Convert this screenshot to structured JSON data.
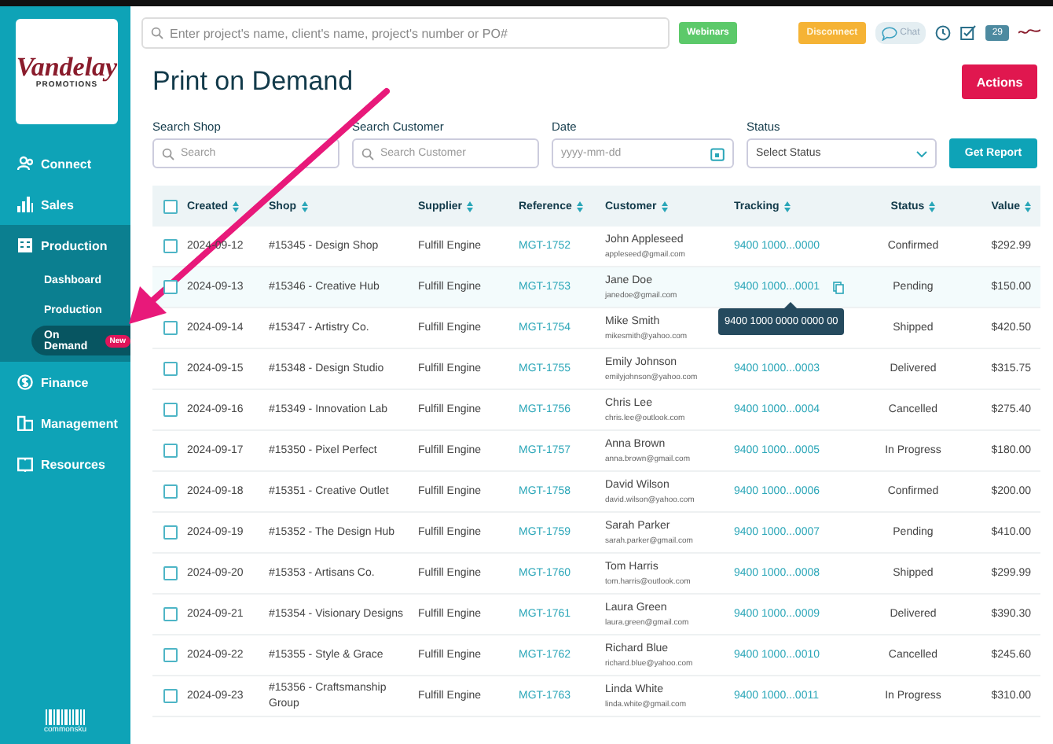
{
  "sidebar": {
    "logo": {
      "title": "Vandelay",
      "subtitle": "PROMOTIONS"
    },
    "items": [
      {
        "label": "Connect",
        "expanded": false
      },
      {
        "label": "Sales",
        "expanded": false
      },
      {
        "label": "Production",
        "expanded": true,
        "children": [
          {
            "label": "Dashboard",
            "selected": false
          },
          {
            "label": "Production",
            "selected": false
          },
          {
            "label": "On Demand",
            "selected": true,
            "badge": "New"
          }
        ]
      },
      {
        "label": "Finance",
        "expanded": false
      },
      {
        "label": "Management",
        "expanded": false
      },
      {
        "label": "Resources",
        "expanded": false
      }
    ],
    "footer_logo": "commonsku"
  },
  "topbar": {
    "search": {
      "placeholder": "Enter project's name, client's name, project's number or PO#"
    },
    "webinars": "Webinars",
    "disconnect": "Disconnect",
    "chat": "Chat",
    "notifications": "29"
  },
  "page": {
    "title": "Print on Demand",
    "actions": "Actions"
  },
  "filters": {
    "shop": {
      "label": "Search Shop",
      "placeholder": "Search"
    },
    "customer": {
      "label": "Search Customer",
      "placeholder": "Search Customer"
    },
    "date": {
      "label": "Date",
      "placeholder": "yyyy-mm-dd"
    },
    "status": {
      "label": "Status",
      "value": "Select Status"
    },
    "submit": "Get Report"
  },
  "table": {
    "all_checked": false,
    "columns": [
      "Created",
      "Shop",
      "Supplier",
      "Reference",
      "Customer",
      "Tracking",
      "Status",
      "Value"
    ],
    "rows": [
      {
        "checked": false,
        "hovered": false,
        "created": "2024-09-12",
        "shop": "#15345 - Design Shop",
        "supplier": "Fulfill Engine",
        "reference": "MGT-1752",
        "customer": "John Appleseed",
        "email": "appleseed@gmail.com",
        "tracking": "9400 1000...0000",
        "status": "Confirmed",
        "value": "$292.99"
      },
      {
        "checked": false,
        "hovered": true,
        "created": "2024-09-13",
        "shop": "#15346 - Creative Hub",
        "supplier": "Fulfill Engine",
        "reference": "MGT-1753",
        "customer": "Jane Doe",
        "email": "janedoe@gmail.com",
        "tracking": "9400 1000...0001",
        "status": "Pending",
        "value": "$150.00",
        "tooltip": "9400 1000 0000 0000 00"
      },
      {
        "checked": false,
        "hovered": false,
        "created": "2024-09-14",
        "shop": "#15347 - Artistry Co.",
        "supplier": "Fulfill Engine",
        "reference": "MGT-1754",
        "customer": "Mike Smith",
        "email": "mikesmith@yahoo.com",
        "status": "Shipped",
        "value": "$420.50"
      },
      {
        "checked": false,
        "hovered": false,
        "created": "2024-09-15",
        "shop": "#15348 - Design Studio",
        "supplier": "Fulfill Engine",
        "reference": "MGT-1755",
        "customer": "Emily Johnson",
        "email": "emilyjohnson@yahoo.com",
        "tracking": "9400 1000...0003",
        "status": "Delivered",
        "value": "$315.75"
      },
      {
        "checked": false,
        "hovered": false,
        "created": "2024-09-16",
        "shop": "#15349 - Innovation Lab",
        "supplier": "Fulfill Engine",
        "reference": "MGT-1756",
        "customer": "Chris Lee",
        "email": "chris.lee@outlook.com",
        "tracking": "9400 1000...0004",
        "status": "Cancelled",
        "value": "$275.40"
      },
      {
        "checked": false,
        "hovered": false,
        "created": "2024-09-17",
        "shop": "#15350 - Pixel Perfect",
        "supplier": "Fulfill Engine",
        "reference": "MGT-1757",
        "customer": "Anna Brown",
        "email": "anna.brown@gmail.com",
        "tracking": "9400 1000...0005",
        "status": "In Progress",
        "value": "$180.00"
      },
      {
        "checked": false,
        "hovered": false,
        "created": "2024-09-18",
        "shop": "#15351 - Creative Outlet",
        "supplier": "Fulfill Engine",
        "reference": "MGT-1758",
        "customer": "David Wilson",
        "email": "david.wilson@yahoo.com",
        "tracking": "9400 1000...0006",
        "status": "Confirmed",
        "value": "$200.00"
      },
      {
        "checked": false,
        "hovered": false,
        "created": "2024-09-19",
        "shop": "#15352 - The Design Hub",
        "supplier": "Fulfill Engine",
        "reference": "MGT-1759",
        "customer": "Sarah Parker",
        "email": "sarah.parker@gmail.com",
        "tracking": "9400 1000...0007",
        "status": "Pending",
        "value": "$410.00"
      },
      {
        "checked": false,
        "hovered": false,
        "created": "2024-09-20",
        "shop": "#15353 - Artisans Co.",
        "supplier": "Fulfill Engine",
        "reference": "MGT-1760",
        "customer": "Tom Harris",
        "email": "tom.harris@outlook.com",
        "tracking": "9400 1000...0008",
        "status": "Shipped",
        "value": "$299.99"
      },
      {
        "checked": false,
        "hovered": false,
        "created": "2024-09-21",
        "shop": "#15354 - Visionary Designs",
        "supplier": "Fulfill Engine",
        "reference": "MGT-1761",
        "customer": "Laura Green",
        "email": "laura.green@gmail.com",
        "tracking": "9400 1000...0009",
        "status": "Delivered",
        "value": "$390.30"
      },
      {
        "checked": false,
        "hovered": false,
        "created": "2024-09-22",
        "shop": "#15355 - Style & Grace",
        "supplier": "Fulfill Engine",
        "reference": "MGT-1762",
        "customer": "Richard Blue",
        "email": "richard.blue@yahoo.com",
        "tracking": "9400 1000...0010",
        "status": "Cancelled",
        "value": "$245.60"
      },
      {
        "checked": false,
        "hovered": false,
        "created": "2024-09-23",
        "shop": "#15356 - Craftsmanship Group",
        "supplier": "Fulfill Engine",
        "reference": "MGT-1763",
        "customer": "Linda White",
        "email": "linda.white@gmail.com",
        "tracking": "9400 1000...0011",
        "status": "In Progress",
        "value": "$310.00"
      }
    ]
  }
}
